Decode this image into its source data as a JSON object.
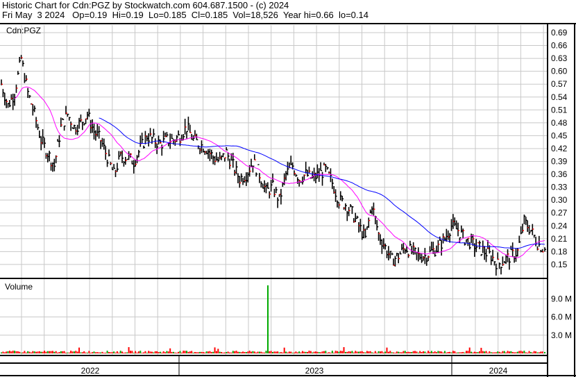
{
  "header": {
    "title": "Historic Chart for Cdn:PGZ by Stockwatch.com 604.687.1500 - (c) 2024",
    "quote": "Fri May  3 2024   Op=0.19  Hi=0.19  Lo=0.185  Cl=0.185  Vol=18,526  Year hi=0.66  lo=0.14"
  },
  "chart_data": {
    "type": "line",
    "symbol_label": "Cdn:PGZ",
    "volume_label": "Volume",
    "price_ticks": [
      "0.69",
      "0.66",
      "0.63",
      "0.60",
      "0.57",
      "0.54",
      "0.51",
      "0.48",
      "0.45",
      "0.42",
      "0.39",
      "0.36",
      "0.33",
      "0.30",
      "0.27",
      "0.24",
      "0.21",
      "0.18",
      "0.15"
    ],
    "ylim": [
      0.13,
      0.71
    ],
    "volume_ticks": [
      "9.0 M",
      "6.0 M",
      "3.0 M"
    ],
    "volume_ylim_millions": [
      0,
      12
    ],
    "year_labels": [
      "2022",
      "2023",
      "2024"
    ],
    "closes_approx": [
      0.57,
      0.52,
      0.55,
      0.63,
      0.55,
      0.5,
      0.44,
      0.41,
      0.38,
      0.47,
      0.5,
      0.47,
      0.48,
      0.5,
      0.46,
      0.44,
      0.4,
      0.36,
      0.4,
      0.4,
      0.39,
      0.42,
      0.45,
      0.44,
      0.43,
      0.44,
      0.44,
      0.45,
      0.47,
      0.44,
      0.43,
      0.42,
      0.4,
      0.39,
      0.41,
      0.38,
      0.35,
      0.36,
      0.39,
      0.36,
      0.32,
      0.33,
      0.3,
      0.36,
      0.38,
      0.35,
      0.36,
      0.35,
      0.36,
      0.37,
      0.34,
      0.3,
      0.29,
      0.27,
      0.24,
      0.21,
      0.29,
      0.22,
      0.19,
      0.16,
      0.17,
      0.19,
      0.18,
      0.17,
      0.17,
      0.18,
      0.19,
      0.21,
      0.24,
      0.23,
      0.21,
      0.2,
      0.19,
      0.18,
      0.17,
      0.15,
      0.16,
      0.17,
      0.18,
      0.25,
      0.23,
      0.2,
      0.185
    ],
    "volume_spike_millions": 11.2,
    "colors": {
      "short_ma": "#ff00ff",
      "long_ma": "#0000ff",
      "bars": "#000000",
      "vol_up": "#00aa00",
      "vol_down": "#ff0000",
      "grid": "#c8c8c8"
    }
  }
}
